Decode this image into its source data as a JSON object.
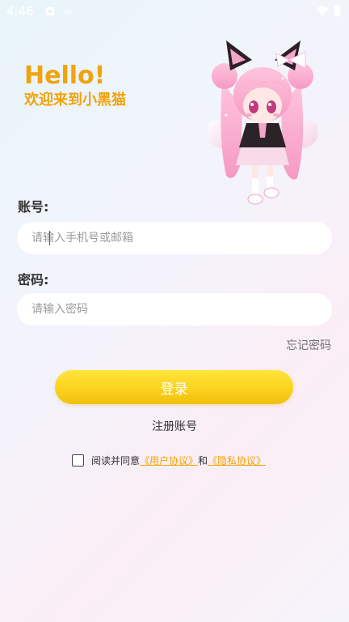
{
  "status_bar": {
    "time": "4:46"
  },
  "greeting": {
    "title": "Hello!",
    "subtitle": "欢迎来到小黑猫"
  },
  "account": {
    "label": "账号:",
    "placeholder": "请输入手机号或邮箱",
    "value": ""
  },
  "password": {
    "label": "密码:",
    "placeholder": "请输入密码",
    "value": ""
  },
  "forgot_password": "忘记密码",
  "login_button": "登录",
  "register_link": "注册账号",
  "agreement": {
    "checked": false,
    "prefix": "阅读并同意",
    "user_agreement": "《用户协议》",
    "conjunction": "和",
    "privacy_agreement": "《隐私协议》"
  },
  "colors": {
    "accent": "#f0a30a",
    "button_top": "#ffe53a",
    "button_bottom": "#f1bf0e"
  },
  "icons": [
    "notification-icon",
    "cast-icon",
    "wifi-icon",
    "battery-icon",
    "mascot-illustration"
  ]
}
